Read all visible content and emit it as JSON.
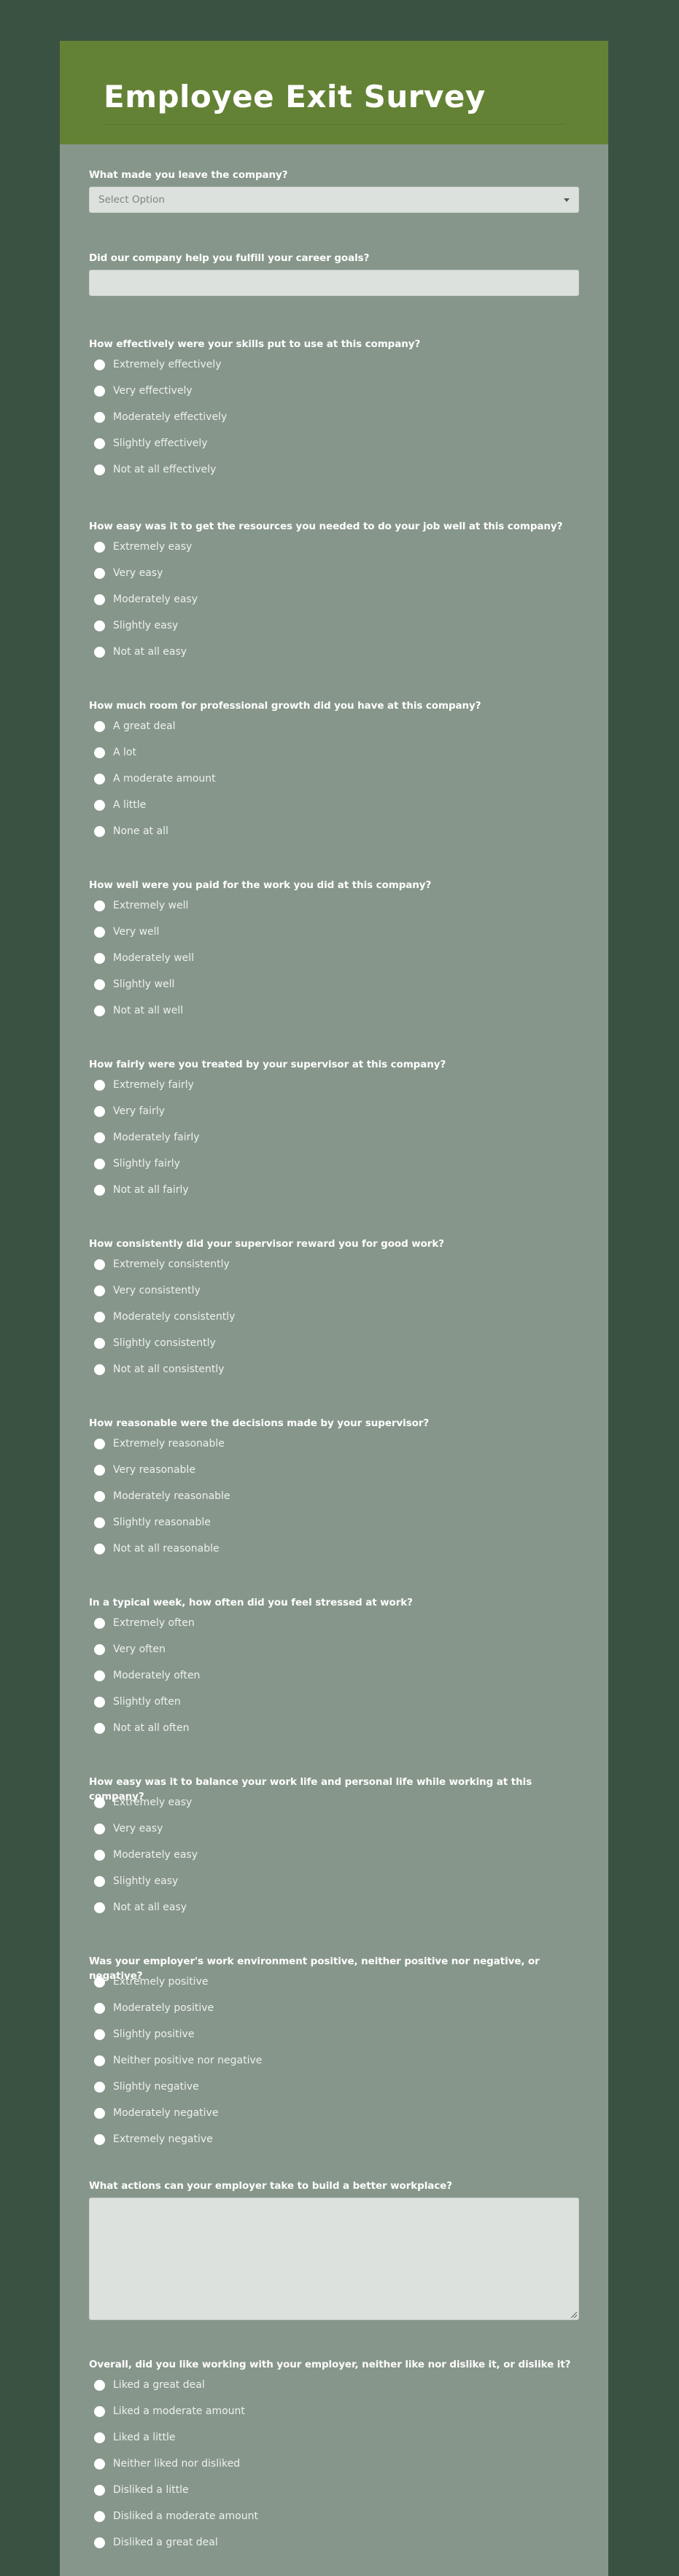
{
  "page": {
    "title": "Employee Exit Survey",
    "colors": {
      "background": "#3a5242",
      "header": "#648235",
      "card": "#87968b",
      "input": "#dce1dd"
    }
  },
  "questions": [
    {
      "type": "select",
      "label": "What made you leave the company?",
      "placeholder": "Select Option"
    },
    {
      "type": "text",
      "label": "Did our company help you fulfill your career goals?",
      "value": ""
    },
    {
      "type": "radio",
      "label": "How effectively were your skills put to use at this company?",
      "options": [
        "Extremely effectively",
        "Very effectively",
        "Moderately effectively",
        "Slightly effectively",
        "Not at all effectively"
      ]
    },
    {
      "type": "radio",
      "label": "How easy was it to get the resources you needed to do your job well at this company?",
      "options": [
        "Extremely easy",
        "Very easy",
        "Moderately easy",
        "Slightly easy",
        "Not at all easy"
      ]
    },
    {
      "type": "radio",
      "label": "How much room for professional growth did you have at this company?",
      "options": [
        "A great deal",
        "A lot",
        "A moderate amount",
        "A little",
        "None at all"
      ]
    },
    {
      "type": "radio",
      "label": "How well were you paid for the work you did at this company?",
      "options": [
        "Extremely well",
        "Very well",
        "Moderately well",
        "Slightly well",
        "Not at all well"
      ]
    },
    {
      "type": "radio",
      "label": "How fairly were you treated by your supervisor at this company?",
      "options": [
        "Extremely fairly",
        "Very fairly",
        "Moderately fairly",
        "Slightly fairly",
        "Not at all fairly"
      ]
    },
    {
      "type": "radio",
      "label": "How consistently did your supervisor reward you for good work?",
      "options": [
        "Extremely consistently",
        "Very consistently",
        "Moderately consistently",
        "Slightly consistently",
        "Not at all consistently"
      ]
    },
    {
      "type": "radio",
      "label": "How reasonable were the decisions made by your supervisor?",
      "options": [
        "Extremely reasonable",
        "Very reasonable",
        "Moderately reasonable",
        "Slightly reasonable",
        "Not at all reasonable"
      ]
    },
    {
      "type": "radio",
      "label": "In a typical week, how often did you feel stressed at work?",
      "options": [
        "Extremely often",
        "Very often",
        "Moderately often",
        "Slightly often",
        "Not at all often"
      ]
    },
    {
      "type": "radio",
      "label": "How easy was it to balance your work life and personal life while working at this company?",
      "options": [
        "Extremely easy",
        "Very easy",
        "Moderately easy",
        "Slightly easy",
        "Not at all easy"
      ]
    },
    {
      "type": "radio",
      "label": "Was your employer's work environment positive, neither positive nor negative, or negative?",
      "options": [
        "Extremely positive",
        "Moderately positive",
        "Slightly positive",
        "Neither positive nor negative",
        "Slightly negative",
        "Moderately negative",
        "Extremely negative"
      ]
    },
    {
      "type": "textarea",
      "label": "What actions can your employer take to build a better workplace?",
      "value": ""
    },
    {
      "type": "radio",
      "label": "Overall, did you like working with your employer, neither like nor dislike it, or dislike it?",
      "options": [
        "Liked a great deal",
        "Liked a moderate amount",
        "Liked a little",
        "Neither liked nor disliked",
        "Disliked a little",
        "Disliked a moderate amount",
        "Disliked a great deal"
      ]
    }
  ]
}
